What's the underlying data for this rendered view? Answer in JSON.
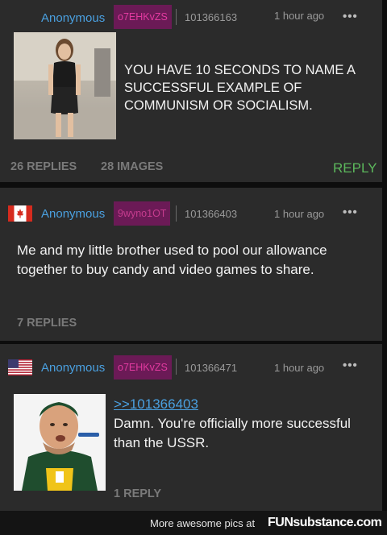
{
  "posts": [
    {
      "author": "Anonymous",
      "poster_id": "o7EHKvZS",
      "post_number": "101366163",
      "time": "1 hour ago",
      "more": "•••",
      "text": "YOU HAVE 10 SECONDS TO NAME A SUCCESSFUL EXAMPLE OF COMMUNISM OR SOCIALISM.",
      "replies": "26 REPLIES",
      "images": "28 IMAGES",
      "reply_button": "REPLY"
    },
    {
      "flag": "canada-flag",
      "author": "Anonymous",
      "poster_id": "9wyno1OT",
      "post_number": "101366403",
      "time": "1 hour ago",
      "more": "•••",
      "text": "Me and my little brother used to pool our allowance together to buy candy and video games to share.",
      "replies": "7 REPLIES"
    },
    {
      "flag": "usa-flag",
      "author": "Anonymous",
      "poster_id": "o7EHKvZS",
      "post_number": "101366471",
      "time": "1 hour ago",
      "more": "•••",
      "quote_link": ">>101366403",
      "text": "Damn. You're officially more successful than the USSR.",
      "replies": "1 REPLY"
    }
  ],
  "footer": {
    "text": "More awesome pics at",
    "brand": "FUNsubstance.com"
  },
  "colors": {
    "accent": "#4aa0e0",
    "poster_id": "#e23aa0",
    "reply": "#5cb85c",
    "card": "#2b2b2b"
  }
}
